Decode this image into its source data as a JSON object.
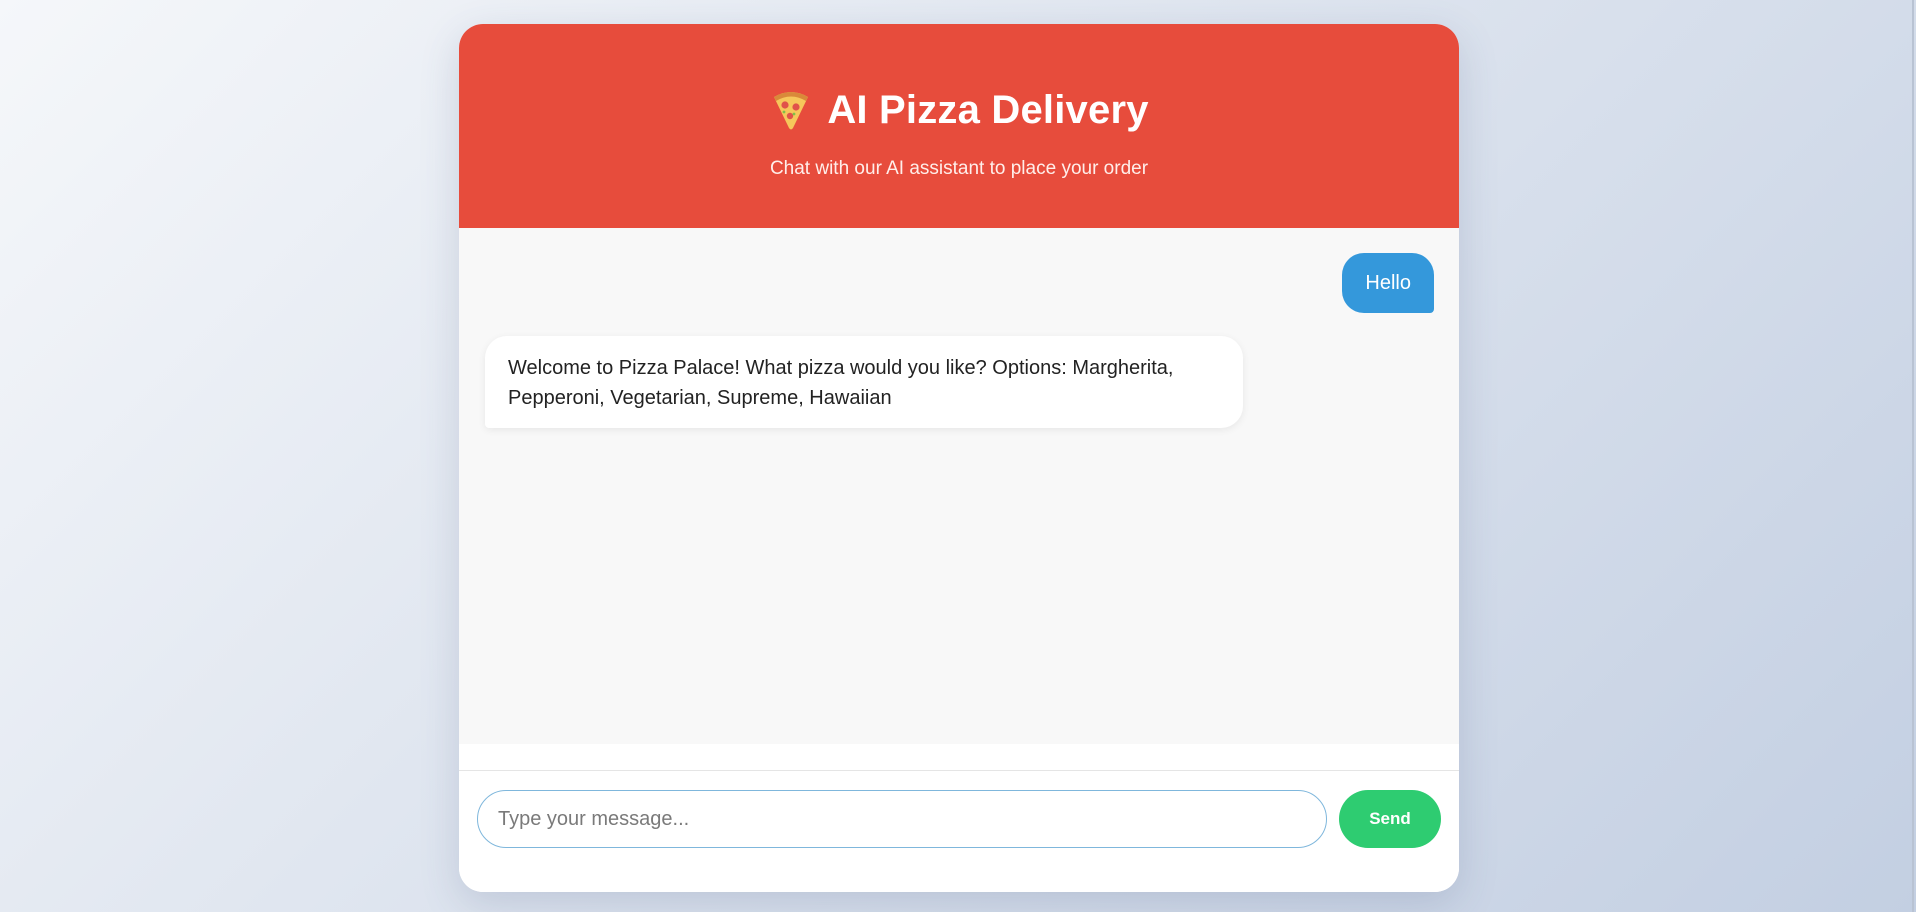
{
  "header": {
    "icon": "pizza-icon",
    "title": "AI Pizza Delivery",
    "subtitle": "Chat with our AI assistant to place your order"
  },
  "messages": [
    {
      "sender": "user",
      "text": "Hello"
    },
    {
      "sender": "bot",
      "text": "Welcome to Pizza Palace! What pizza would you like? Options: Margherita, Pepperoni, Vegetarian, Supreme, Hawaiian"
    }
  ],
  "input": {
    "placeholder": "Type your message...",
    "value": ""
  },
  "send_button": {
    "label": "Send"
  },
  "colors": {
    "header_bg": "#e74c3c",
    "user_bubble": "#3498db",
    "send_button": "#2ecc71",
    "chat_bg": "#f8f8f8"
  }
}
